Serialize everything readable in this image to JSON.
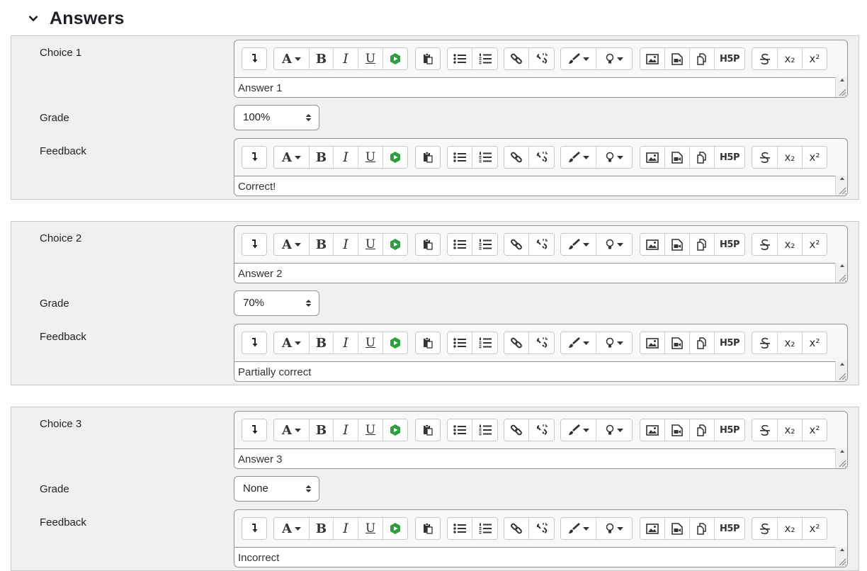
{
  "section": {
    "title": "Answers",
    "toggle_icon": "chevron-down-icon"
  },
  "labels": {
    "grade": "Grade",
    "feedback": "Feedback"
  },
  "choices": [
    {
      "label": "Choice 1",
      "answer": "Answer 1",
      "grade": "100%",
      "feedback": "Correct!"
    },
    {
      "label": "Choice 2",
      "answer": "Answer 2",
      "grade": "70%",
      "feedback": "Partially correct"
    },
    {
      "label": "Choice 3",
      "answer": "Answer 3",
      "grade": "None",
      "feedback": "Incorrect"
    }
  ],
  "toolbar": {
    "bold": "B",
    "italic": "I",
    "underline": "U",
    "h5p": "H5P",
    "subscript": "x₂",
    "superscript": "x²"
  },
  "colors": {
    "fieldset_bg": "#f0f0f0",
    "border": "#8f959e",
    "text": "#1d2125"
  }
}
